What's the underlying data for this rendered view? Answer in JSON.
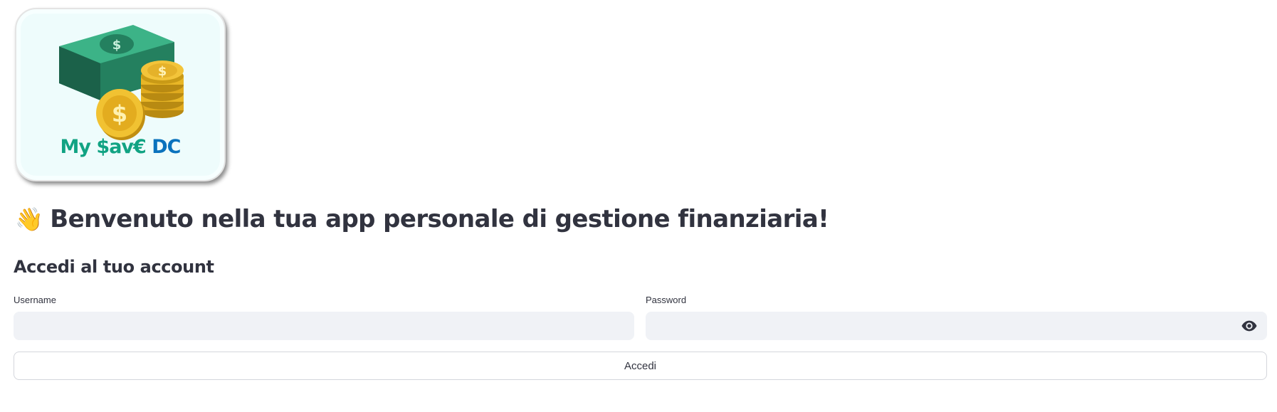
{
  "logo": {
    "name_part1": "My $av€",
    "name_part2": "DC",
    "icon": "money-stack-coins-icon"
  },
  "welcome": {
    "emoji": "👋",
    "text": "Benvenuto nella tua app personale di gestione finanziaria!"
  },
  "login": {
    "title": "Accedi al tuo account",
    "username_label": "Username",
    "username_value": "",
    "password_label": "Password",
    "password_value": "",
    "toggle_icon": "eye-icon",
    "submit_label": "Accedi"
  }
}
